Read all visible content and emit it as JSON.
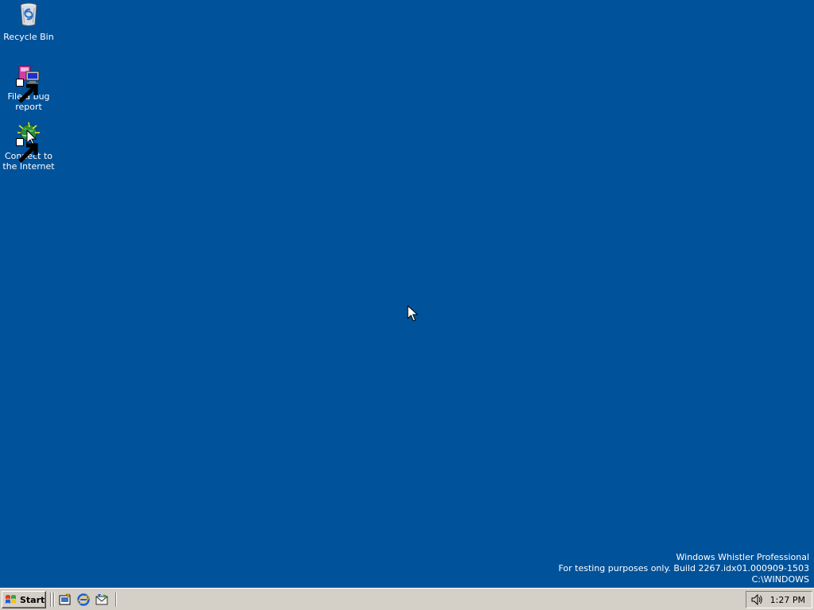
{
  "desktop": {
    "background": "#00529b",
    "icons": [
      {
        "label": "Recycle Bin",
        "icon": "recycle-bin-icon"
      },
      {
        "label": "File a bug report",
        "icon": "bug-report-icon"
      },
      {
        "label": "Connect to the Internet",
        "icon": "connect-internet-icon"
      }
    ],
    "watermark": {
      "line1": "Windows Whistler Professional",
      "line2": "For testing purposes only. Build 2267.idx01.000909-1503",
      "line3": "C:\\WINDOWS"
    }
  },
  "taskbar": {
    "start_label": "Start",
    "quick_launch": [
      {
        "name": "show-desktop-icon"
      },
      {
        "name": "internet-explorer-icon"
      },
      {
        "name": "outlook-express-icon"
      }
    ],
    "tray": {
      "volume_icon": "volume-icon",
      "clock": "1:27 PM"
    }
  }
}
